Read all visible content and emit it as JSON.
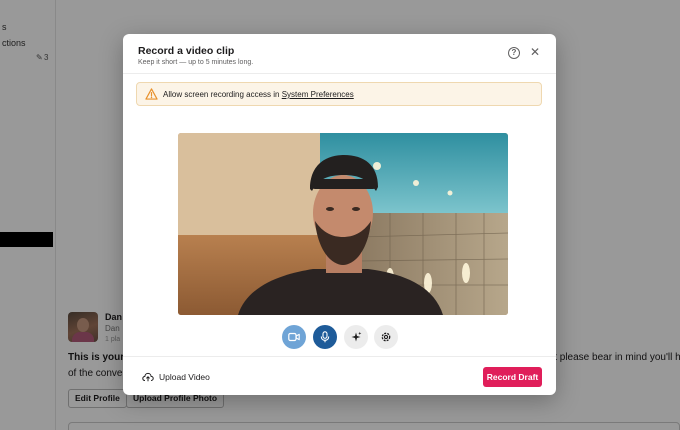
{
  "background": {
    "top_fragment": "s",
    "top_fragment2": "ctions",
    "pencil_count": "3",
    "profile": {
      "name": "Dan",
      "line2": "Dan",
      "line3": "1 pla"
    },
    "message_left": "This is your s",
    "message_left2": "of the conver",
    "message_right": "it please bear in mind you'll ha",
    "buttons": {
      "edit_profile": "Edit Profile",
      "upload_profile_photo": "Upload Profile Photo"
    }
  },
  "modal": {
    "title": "Record a video clip",
    "subtitle": "Keep it short — up to 5 minutes long.",
    "help_icon": "question-circle-icon",
    "close_icon": "close-icon",
    "alert": {
      "icon": "warning-triangle-icon",
      "text": "Allow screen recording access in ",
      "link": "System Preferences"
    },
    "controls": [
      {
        "name": "camera",
        "icon": "video-camera-icon",
        "active": true
      },
      {
        "name": "microphone",
        "icon": "microphone-icon",
        "active": true
      },
      {
        "name": "effects",
        "icon": "sparkles-icon",
        "active": false
      },
      {
        "name": "settings",
        "icon": "gear-icon",
        "active": false
      }
    ],
    "footer": {
      "upload_video": "Upload Video",
      "record_draft": "Record Draft"
    }
  },
  "colors": {
    "accent": "#e01e5a",
    "mic_active": "#1e5b99",
    "camera_active": "#6fa4d6",
    "alert_bg": "#fcf4e7",
    "alert_icon": "#e8912d"
  }
}
